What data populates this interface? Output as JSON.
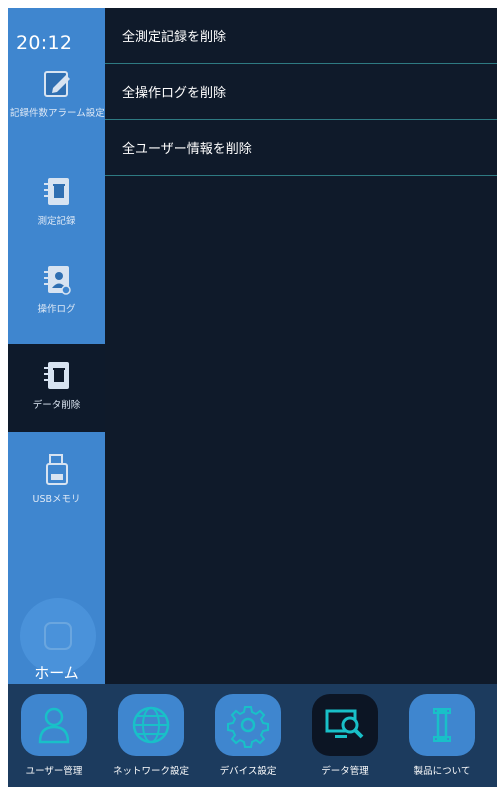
{
  "status": {
    "time": "20:12"
  },
  "sidebar": {
    "items": [
      {
        "label": "記録件数アラーム設定",
        "icon": "edit-note-icon"
      },
      {
        "label": "測定記録",
        "icon": "notebook-trash-icon"
      },
      {
        "label": "操作ログ",
        "icon": "notebook-user-icon"
      },
      {
        "label": "データ削除",
        "icon": "notebook-trash-icon",
        "active": true
      },
      {
        "label": "USBメモリ",
        "icon": "usb-drive-icon"
      }
    ],
    "home_label": "ホーム"
  },
  "main": {
    "actions": [
      {
        "label": "全測定記録を削除"
      },
      {
        "label": "全操作ログを削除"
      },
      {
        "label": "全ユーザー情報を削除"
      }
    ]
  },
  "bottom_nav": {
    "items": [
      {
        "label": "ユーザー管理",
        "icon": "user-icon"
      },
      {
        "label": "ネットワーク設定",
        "icon": "globe-icon"
      },
      {
        "label": "デバイス設定",
        "icon": "gear-icon"
      },
      {
        "label": "データ管理",
        "icon": "monitor-search-icon",
        "active": true
      },
      {
        "label": "製品について",
        "icon": "info-icon"
      }
    ]
  },
  "colors": {
    "sidebar": "#3f86cf",
    "content_bg": "#0f1a2a",
    "divider": "#2e7a82",
    "bottom_bar": "#1c3b5e",
    "icon_teal": "#19c0c8"
  }
}
